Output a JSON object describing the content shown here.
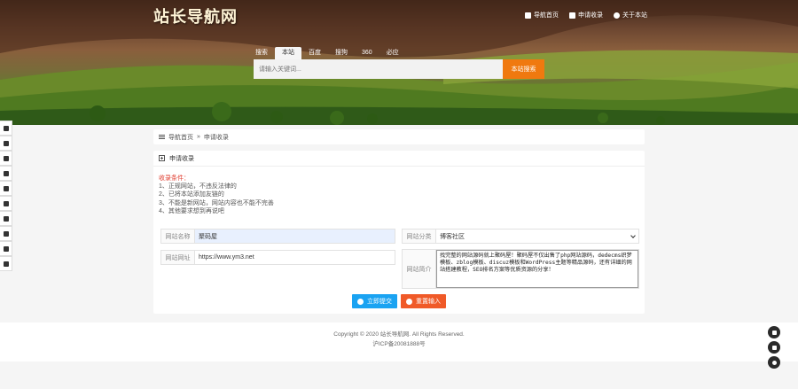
{
  "site": {
    "logo": "站长导航网"
  },
  "topnav": [
    {
      "label": "导航首页",
      "icon": "home-icon"
    },
    {
      "label": "申请收录",
      "icon": "plus-square-icon"
    },
    {
      "label": "关于本站",
      "icon": "info-icon"
    }
  ],
  "search": {
    "tabs": [
      "搜索",
      "本站",
      "百度",
      "搜狗",
      "360",
      "必应"
    ],
    "active_tab": "本站",
    "placeholder": "请输入关键词...",
    "button": "本站搜索"
  },
  "rail_icons": [
    "thumbs-up-icon",
    "send-icon",
    "file-icon",
    "settings-icon",
    "video-icon",
    "cloud-icon",
    "chart-icon",
    "graduation-icon",
    "yen-icon",
    "grid-icon"
  ],
  "breadcrumb": {
    "home": "导航首页",
    "sep": "»",
    "current": "申请收录"
  },
  "card": {
    "title": "申请收录",
    "rules_title": "收录条件：",
    "rules": [
      "1、正规网站，不违反法律的",
      "2、已将本站添加友链的",
      "3、不能是新网站，网站内容也不能不完善",
      "4、其他要求想到再说吧"
    ]
  },
  "form": {
    "name_label": "网站名称",
    "name_value": "聚码屋",
    "url_label": "网站网址",
    "url_value": "https://www.ym3.net",
    "category_label": "网站分类",
    "category_value": "博客社区",
    "intro_label": "网站简介",
    "intro_value": "找完整的网站源码就上聚码屋！聚码屋不仅出售了php网站源码，dedecms织梦模板、zblog模板、discuz模板和WordPress主题等精品源码，还有详细的网站搭建教程，SEO排名方案等优质资源的分享！",
    "submit": "立即提交",
    "reset": "重置输入"
  },
  "footer": {
    "copyright": "Copyright © 2020 站长导航网. All Rights Reserved.",
    "icp": "沪ICP备20081888号"
  },
  "colors": {
    "accent": "#f0790f",
    "submit": "#1aa3f2",
    "reset": "#f05a28",
    "required": "#e03c2f"
  }
}
